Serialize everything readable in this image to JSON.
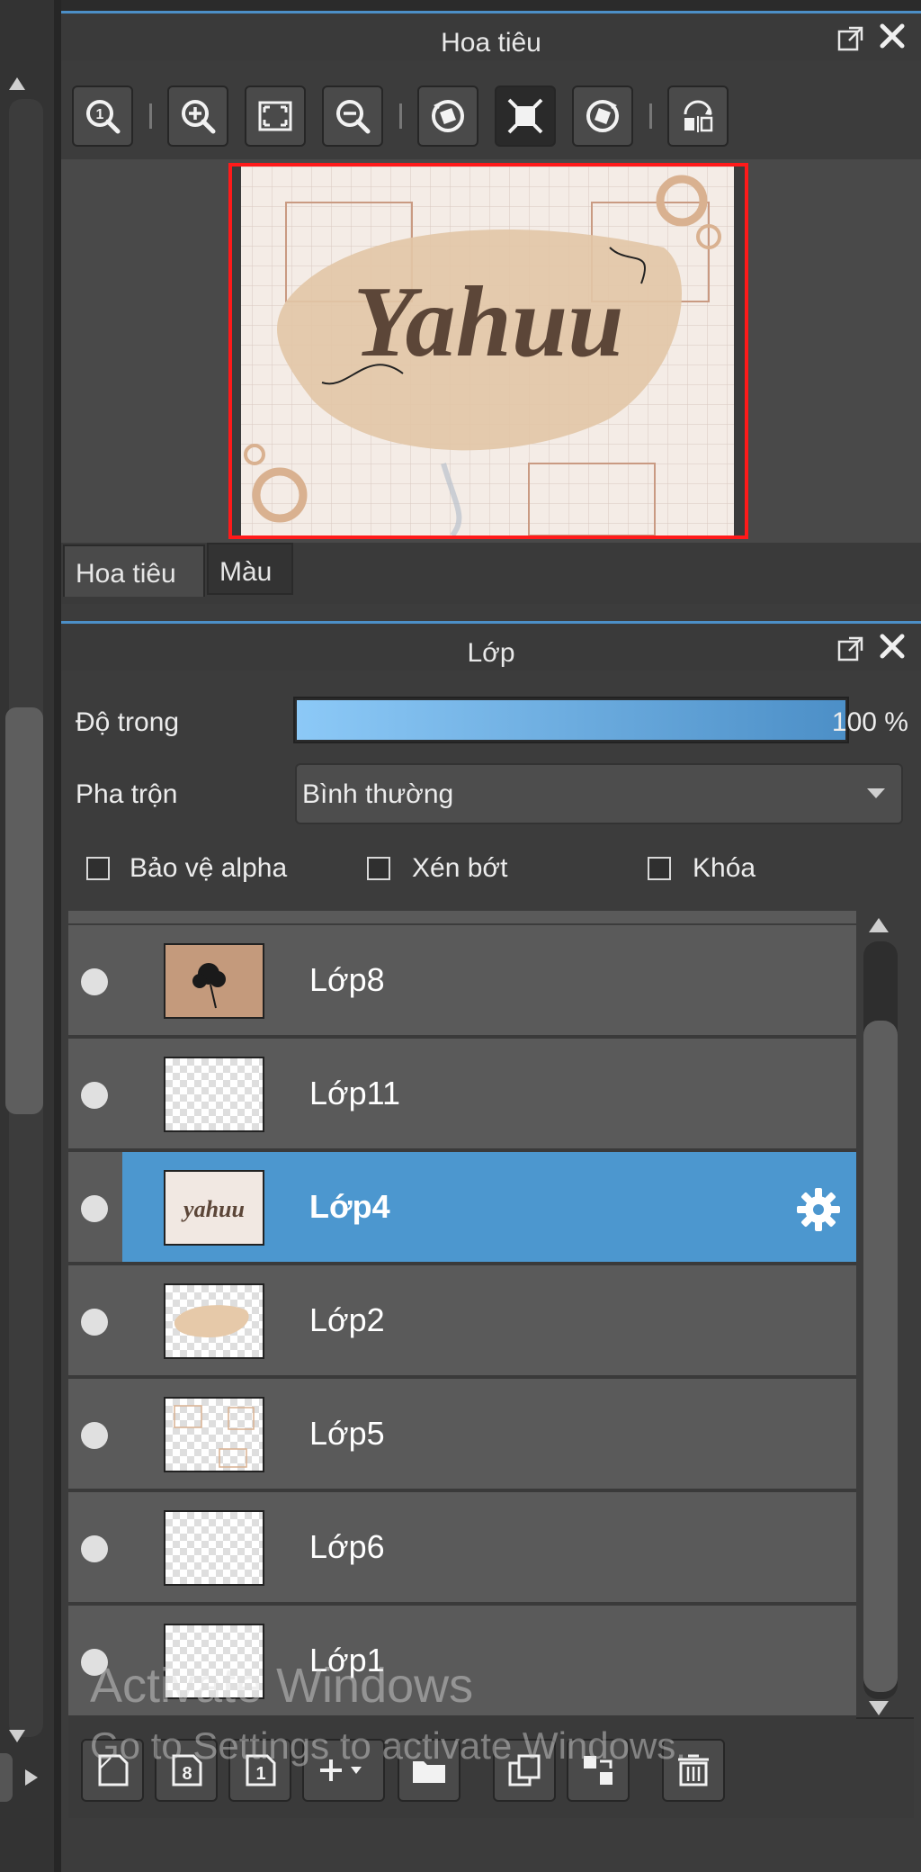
{
  "navigator": {
    "title": "Hoa tiêu",
    "tabs": [
      {
        "label": "Hoa tiêu",
        "active": true
      },
      {
        "label": "Màu",
        "active": false
      }
    ],
    "toolbar_icons": [
      "zoom-reset-icon",
      "zoom-in-icon",
      "fit-screen-icon",
      "zoom-out-icon",
      "rotate-left-icon",
      "fit-window-icon",
      "rotate-right-icon",
      "flip-horizontal-icon"
    ],
    "preview_text": "Yahuu",
    "view_frame_color": "#ff1a1a"
  },
  "layers": {
    "title": "Lớp",
    "opacity_label": "Độ trong",
    "opacity_value": "100 %",
    "opacity_fraction": 1.0,
    "blend_label": "Pha trộn",
    "blend_value": "Bình thường",
    "alpha_protect_label": "Bảo vệ alpha",
    "clipping_label": "Xén bớt",
    "lock_label": "Khóa",
    "items": [
      {
        "name": "Lớp8",
        "selected": false,
        "thumb": "flower"
      },
      {
        "name": "Lớp11",
        "selected": false,
        "thumb": "empty"
      },
      {
        "name": "Lớp4",
        "selected": true,
        "thumb": "text",
        "thumb_text": "yahuu"
      },
      {
        "name": "Lớp2",
        "selected": false,
        "thumb": "blob"
      },
      {
        "name": "Lớp5",
        "selected": false,
        "thumb": "frames"
      },
      {
        "name": "Lớp6",
        "selected": false,
        "thumb": "empty"
      },
      {
        "name": "Lớp1",
        "selected": false,
        "thumb": "empty"
      }
    ],
    "bottom_icons": [
      "new-layer-icon",
      "new-8bit-layer-icon",
      "new-1bit-layer-icon",
      "add-layer-menu-icon",
      "new-folder-icon",
      "duplicate-layer-icon",
      "merge-down-icon",
      "delete-layer-icon"
    ]
  },
  "watermark": {
    "line1": "Activate Windows",
    "line2": "Go to Settings to activate Windows."
  },
  "colors": {
    "accent": "#4c97cf",
    "panel_bg": "#3a3a3a",
    "row_bg": "#5a5a5a"
  }
}
